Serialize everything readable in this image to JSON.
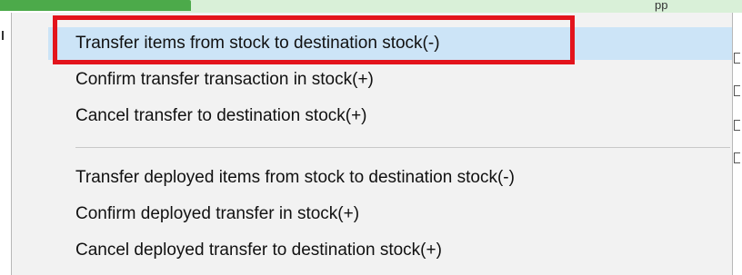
{
  "menu": {
    "items": [
      {
        "label": "Transfer items from stock to destination stock(-)",
        "highlighted": true
      },
      {
        "label": "Confirm transfer transaction in stock(+)",
        "highlighted": false
      },
      {
        "label": "Cancel transfer to destination stock(+)",
        "highlighted": false
      },
      {
        "label": "Transfer deployed items from stock to destination stock(-)",
        "highlighted": false
      },
      {
        "label": "Confirm deployed transfer in stock(+)",
        "highlighted": false
      },
      {
        "label": "Cancel deployed transfer to destination stock(+)",
        "highlighted": false
      }
    ]
  },
  "colors": {
    "menu_background": "#f2f2f2",
    "hover_highlight": "#cce4f7",
    "annotation_box": "#e3141c",
    "header_green": "#4caa4a",
    "header_light_green": "#d9f0d8"
  },
  "header": {
    "partial_text": "pp"
  }
}
